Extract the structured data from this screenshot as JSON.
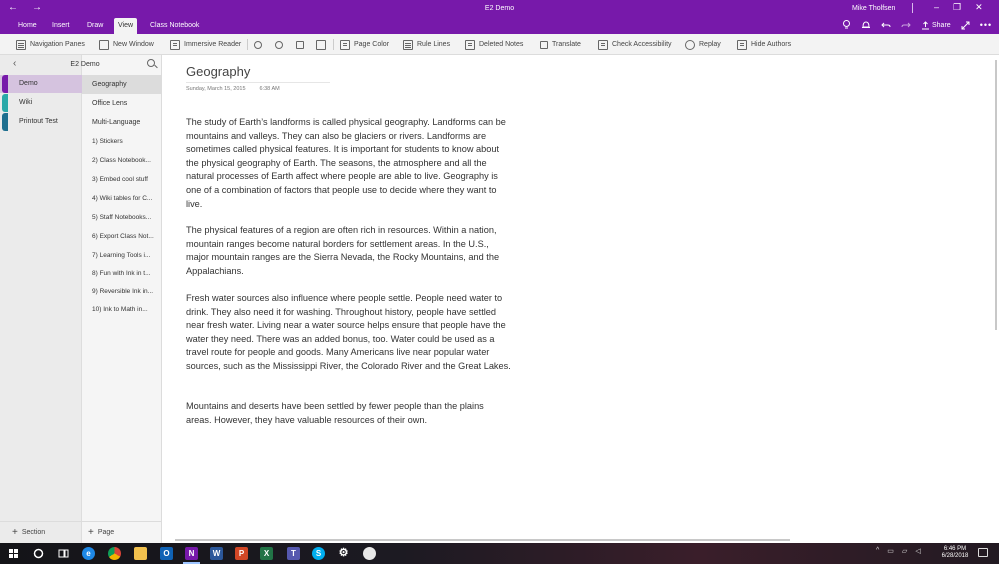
{
  "window": {
    "title": "E2 Demo",
    "user": "Mike Tholfsen",
    "back_glyph": "←",
    "forward_glyph": "→",
    "minimize_glyph": "–",
    "restore_glyph": "❐",
    "close_glyph": "✕"
  },
  "ribbon": {
    "tabs": [
      "Home",
      "Insert",
      "Draw",
      "View",
      "Class Notebook"
    ],
    "active_tab": "View",
    "share_label": "Share",
    "right_icons": [
      "lightbulb-icon",
      "bell-icon",
      "undo-icon",
      "redo-icon"
    ]
  },
  "toolbar": {
    "items": [
      {
        "label": "Navigation Panes",
        "icon": "navigation-panes-icon"
      },
      {
        "label": "New Window",
        "icon": "new-window-icon"
      },
      {
        "label": "Immersive Reader",
        "icon": "immersive-reader-icon"
      },
      {
        "label": "",
        "icon": "zoom-out-icon"
      },
      {
        "label": "",
        "icon": "zoom-in-icon"
      },
      {
        "label": "",
        "icon": "zoom-100-icon"
      },
      {
        "label": "",
        "icon": "fit-page-icon"
      },
      {
        "label": "Page Color",
        "icon": "page-color-icon"
      },
      {
        "label": "Rule Lines",
        "icon": "rule-lines-icon"
      },
      {
        "label": "Deleted Notes",
        "icon": "deleted-notes-icon"
      },
      {
        "label": "Translate",
        "icon": "translate-icon"
      },
      {
        "label": "Check Accessibility",
        "icon": "accessibility-icon"
      },
      {
        "label": "Replay",
        "icon": "replay-icon"
      },
      {
        "label": "Hide Authors",
        "icon": "hide-authors-icon"
      }
    ]
  },
  "nav": {
    "notebook_name": "E2 Demo",
    "sections": [
      {
        "label": "Demo",
        "color": "#7719aa",
        "active": true
      },
      {
        "label": "Wiki",
        "color": "#2aa8a8",
        "active": false
      },
      {
        "label": "Printout Test",
        "color": "#1e6f8f",
        "active": false
      }
    ],
    "pages": [
      "Geography",
      "Office Lens",
      "Multi-Language",
      "1) Stickers",
      "2) Class Notebook...",
      "3) Embed cool stuff",
      "4) Wiki tables for C...",
      "5) Staff Notebooks...",
      "6) Export Class Not...",
      "7) Learning Tools i...",
      "8) Fun with Ink in t...",
      "9) Reversible Ink in...",
      "10) Ink to Math in..."
    ],
    "active_page": "Geography",
    "add_section_label": "Section",
    "add_page_label": "Page",
    "plus_glyph": "+"
  },
  "page": {
    "title": "Geography",
    "date": "Sunday, March 15, 2015",
    "time": "6:38 AM",
    "paragraphs": [
      "The study of Earth’s landforms is called physical geography. Landforms can be mountains and valleys. They can also be glaciers or rivers. Landforms are sometimes called physical features. It is important for students to know about the physical geography of Earth. The seasons, the atmosphere and all the natural processes of Earth affect where people are able to live. Geography is one of a combination of factors that people use to decide where they want to live.",
      "The physical features of a region are often rich in resources. Within a nation, mountain ranges become natural borders for settlement areas. In the U.S., major mountain ranges are the Sierra Nevada, the Rocky Mountains, and the Appalachians.",
      "Fresh water sources also influence where people settle. People need water to drink. They also need it for washing. Throughout history, people have settled near fresh water. Living near a water source helps ensure that people have the water they need. There was an added bonus, too. Water could be used as a travel route for people and goods. Many Americans live near popular water sources, such as the Mississippi River, the Colorado River and the Great Lakes.",
      "Mountains and deserts have been settled by fewer people than the plains areas. However, they have valuable resources of their own."
    ]
  },
  "taskbar": {
    "apps": [
      {
        "name": "start-icon",
        "color": "#ffffff"
      },
      {
        "name": "cortana-icon",
        "color": "#ffffff"
      },
      {
        "name": "task-view-icon",
        "color": "#ffffff"
      },
      {
        "name": "edge-icon",
        "color": "#1e88e5"
      },
      {
        "name": "chrome-icon",
        "color": "#e0b020"
      },
      {
        "name": "file-explorer-icon",
        "color": "#f2c14e"
      },
      {
        "name": "outlook-icon",
        "color": "#0f62b5"
      },
      {
        "name": "onenote-icon",
        "color": "#7719aa"
      },
      {
        "name": "word-icon",
        "color": "#2b579a"
      },
      {
        "name": "powerpoint-icon",
        "color": "#d24726"
      },
      {
        "name": "excel-icon",
        "color": "#217346"
      },
      {
        "name": "teams-icon",
        "color": "#5558af"
      },
      {
        "name": "skype-icon",
        "color": "#00aff0"
      },
      {
        "name": "settings-icon",
        "color": "#ffffff"
      },
      {
        "name": "paint-icon",
        "color": "#e8e8e8"
      }
    ],
    "time": "6:46 PM",
    "date": "6/28/2018"
  },
  "colors": {
    "accent": "#7719aa"
  }
}
